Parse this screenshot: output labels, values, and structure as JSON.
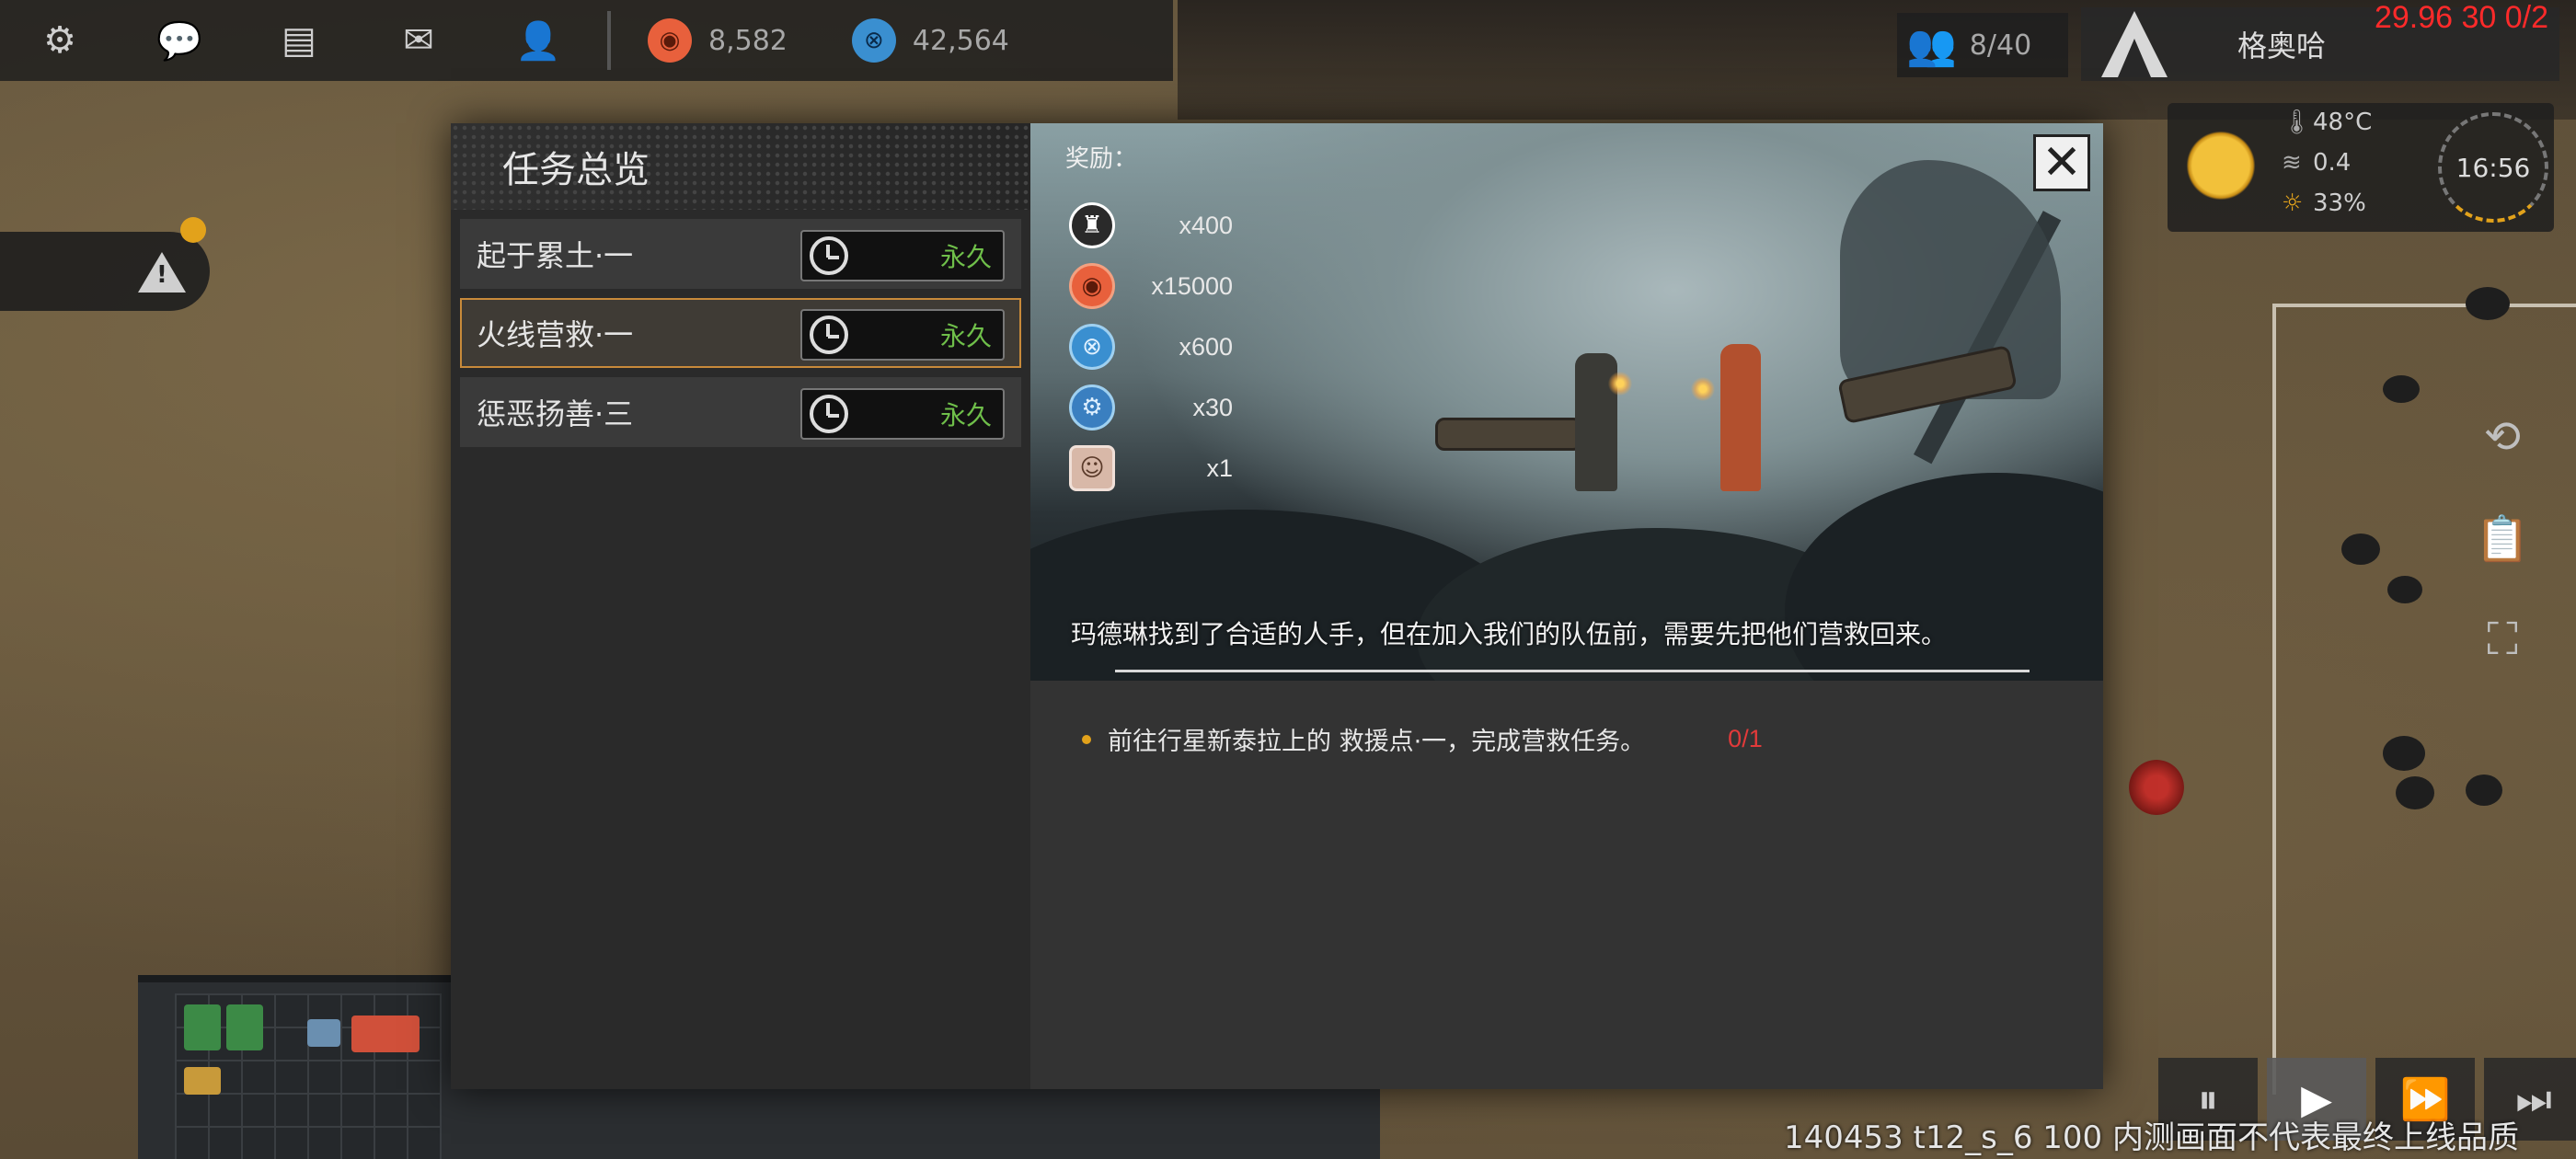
{
  "hud": {
    "menu_icons": [
      "gear-icon",
      "chat-icon",
      "mailbox-icon",
      "mail-icon",
      "contacts-icon"
    ],
    "resources": [
      {
        "icon": "orange-cat-coin-icon",
        "value": "8,582",
        "color": "#e8603c"
      },
      {
        "icon": "blue-crystal-coin-icon",
        "value": "42,564",
        "color": "#3a8fd0"
      }
    ],
    "population": "8/40",
    "player_name": "格奥哈",
    "debug_text": "29.96 30 0/2",
    "weather": {
      "temperature": "48°C",
      "wind": "0.4",
      "humidity": "33%",
      "clock": "16:56"
    },
    "accent_color": "#e2a21b"
  },
  "quest_panel": {
    "title": "任务总览",
    "quests": [
      {
        "name": "起于累土·一",
        "duration": "永久",
        "selected": false
      },
      {
        "name": "火线营救·一",
        "duration": "永久",
        "selected": true
      },
      {
        "name": "惩恶扬善·三",
        "duration": "永久",
        "selected": false
      }
    ]
  },
  "detail": {
    "reward_label": "奖励：",
    "rewards": [
      {
        "icon": "tower-token-icon",
        "amount": "x400"
      },
      {
        "icon": "orange-cat-coin-icon",
        "amount": "x15000"
      },
      {
        "icon": "blue-crystal-coin-icon",
        "amount": "x600"
      },
      {
        "icon": "blue-gear-token-icon",
        "amount": "x30"
      },
      {
        "icon": "survivor-portrait-icon",
        "amount": "x1"
      }
    ],
    "description": "玛德琳找到了合适的人手，但在加入我们的队伍前，需要先把他们营救回来。",
    "objective": {
      "text": "前往行星新泰拉上的 救援点·一，完成营救任务。",
      "progress": "0/1"
    }
  },
  "footer": {
    "note": "140453 t12_s_6 100  内测画面不代表最终上线品质"
  }
}
